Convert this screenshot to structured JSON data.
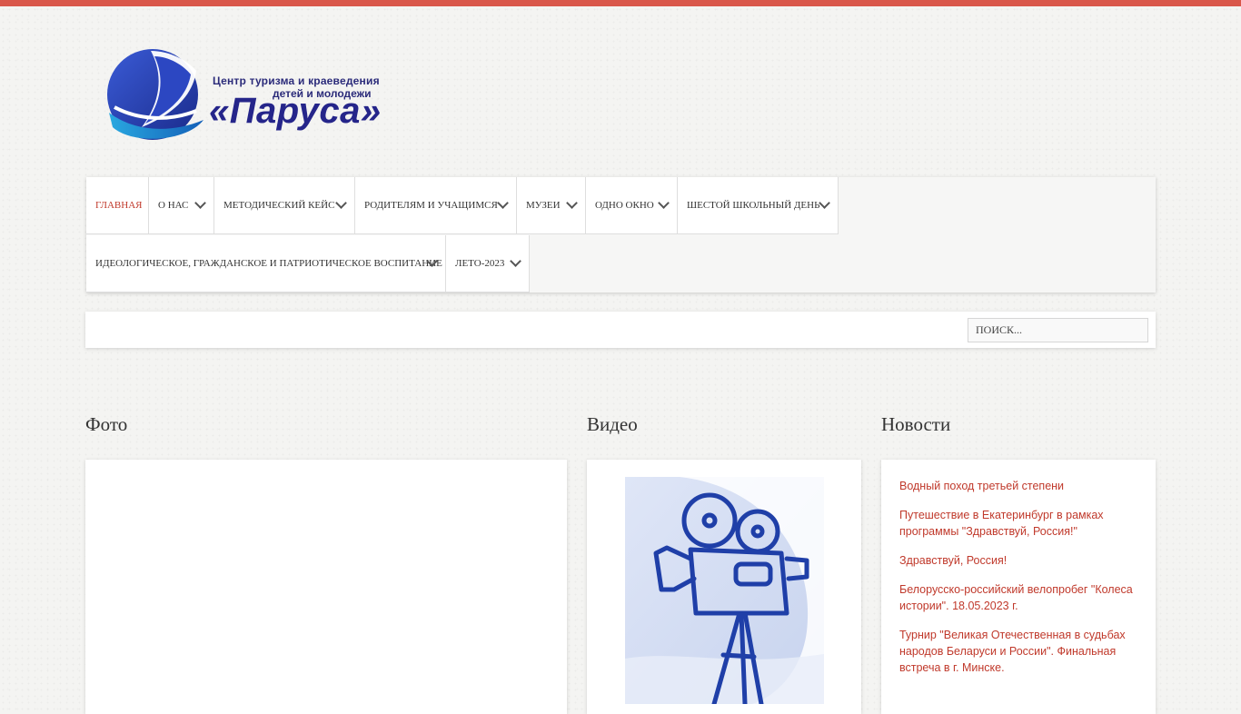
{
  "logo": {
    "line1": "Центр туризма и краеведения",
    "line2": "детей и молодежи",
    "name": "«Паруса»"
  },
  "nav": {
    "row1": [
      {
        "label": "Главная",
        "active": true,
        "dropdown": false
      },
      {
        "label": "О нас",
        "active": false,
        "dropdown": true
      },
      {
        "label": "Методический кейс",
        "active": false,
        "dropdown": true
      },
      {
        "label": "Родителям и учащимся",
        "active": false,
        "dropdown": true
      },
      {
        "label": "Музеи",
        "active": false,
        "dropdown": true
      },
      {
        "label": "Одно окно",
        "active": false,
        "dropdown": true
      },
      {
        "label": "Шестой школьный день",
        "active": false,
        "dropdown": true
      }
    ],
    "row2": [
      {
        "label": "Идеологическое, гражданское и патриотическое воспитание",
        "active": false,
        "dropdown": true
      },
      {
        "label": "Лето-2023",
        "active": false,
        "dropdown": true
      }
    ]
  },
  "search": {
    "placeholder": "Поиск..."
  },
  "sections": {
    "photo_title": "Фото",
    "video_title": "Видео",
    "news_title": "Новости"
  },
  "news": [
    "Водный поход третьей степени",
    "Путешествие в Екатеринбург в рамках программы \"Здравствуй, Россия!\"",
    "Здравствуй, Россия!",
    "Белорусско-российский велопробег \"Колеса истории\". 18.05.2023 г.",
    "Турнир \"Великая Отечественная в судьбах народов Беларуси и России\". Финальная встреча в г. Минске."
  ],
  "colors": {
    "accent": "#d9574a",
    "link": "#c0392b",
    "logo_blue": "#25258a",
    "camera_blue": "#1f3fa8"
  }
}
